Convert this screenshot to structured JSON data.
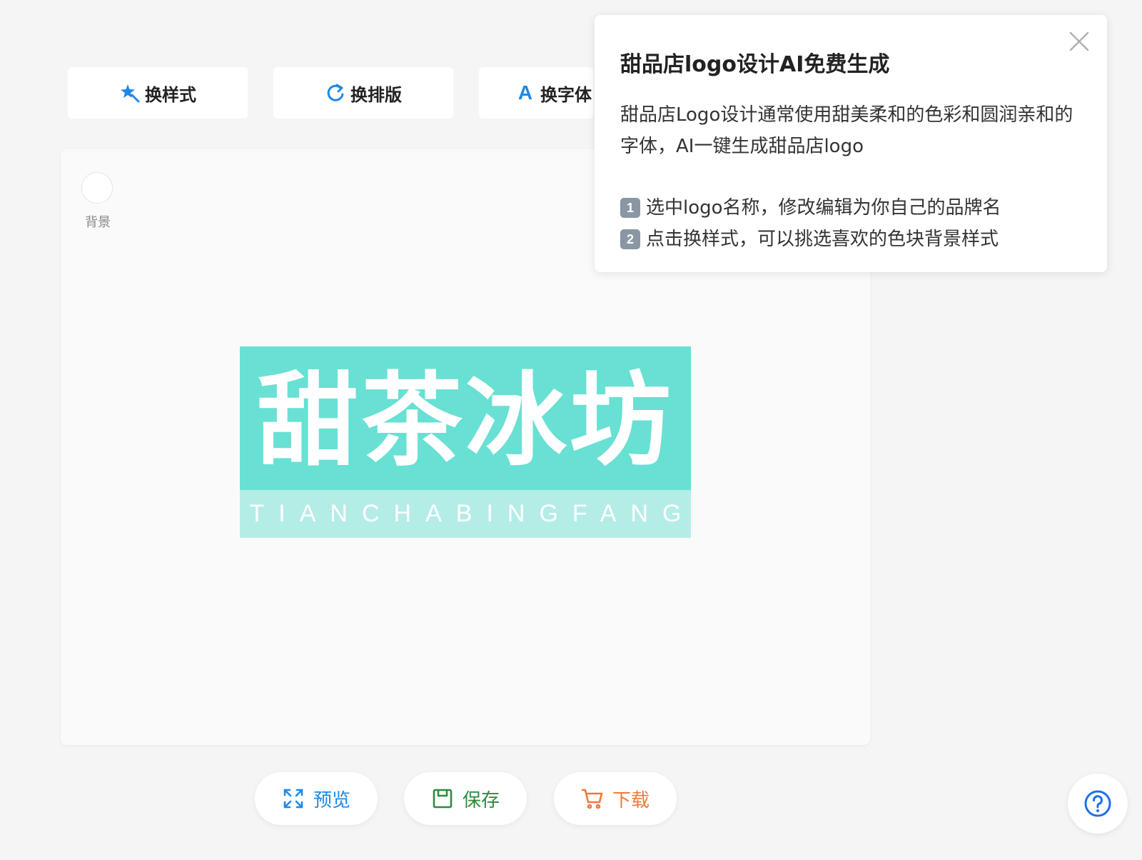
{
  "toolbar": {
    "style_label": "换样式",
    "layout_label": "换排版",
    "font_label": "换字体",
    "font_icon_glyph": "A"
  },
  "canvas": {
    "background_label": "背景",
    "background_color": "#ffffff"
  },
  "logo": {
    "name": "甜茶冰坊",
    "pinyin": "TIANCHABINGFANG",
    "top_color": "#68e0d3",
    "bottom_color": "#b4ede6"
  },
  "actions": {
    "preview_label": "预览",
    "save_label": "保存",
    "download_label": "下载"
  },
  "popup": {
    "title": "甜品店logo设计AI免费生成",
    "description": "甜品店Logo设计通常使用甜美柔和的色彩和圆润亲和的字体，AI一键生成甜品店logo",
    "steps": [
      {
        "badge": "1",
        "text": "选中logo名称，修改编辑为你自己的品牌名"
      },
      {
        "badge": "2",
        "text": "点击换样式，可以挑选喜欢的色块背景样式"
      }
    ]
  },
  "icons": {
    "style": "magic-star-icon",
    "layout": "refresh-icon",
    "font": "font-a-icon",
    "preview": "expand-icon",
    "save": "save-icon",
    "download": "cart-icon",
    "help": "help-icon",
    "close": "close-icon"
  },
  "colors": {
    "accent_blue": "#1e88e5",
    "save_green": "#2e8b3e",
    "download_orange": "#f07a3a"
  }
}
